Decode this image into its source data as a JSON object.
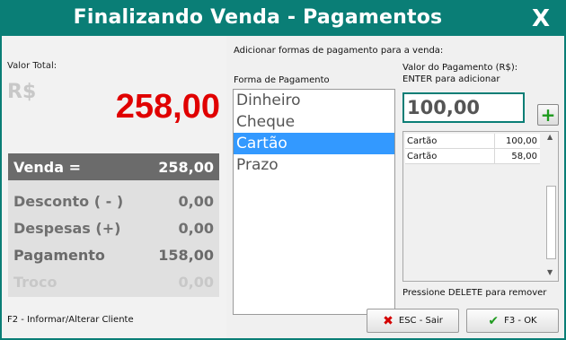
{
  "window": {
    "title": "Finalizando Venda - Pagamentos",
    "close_label": "X"
  },
  "left": {
    "total_label": "Valor Total:",
    "currency": "R$",
    "total_value": "258,00",
    "rows": [
      {
        "label": "Venda =",
        "value": "258,00"
      },
      {
        "label": "Desconto ( - )",
        "value": "0,00"
      },
      {
        "label": "Despesas (+)",
        "value": "0,00"
      },
      {
        "label": "Pagamento",
        "value": "158,00"
      },
      {
        "label": "Troco",
        "value": "0,00"
      }
    ],
    "hint": "F2 - Informar/Alterar Cliente"
  },
  "right": {
    "header": "Adicionar formas de pagamento para a venda:",
    "forma_label": "Forma de Pagamento",
    "valor_label_1": "Valor do Pagamento (R$):",
    "valor_label_2": "ENTER para adicionar",
    "forms": [
      "Dinheiro",
      "Cheque",
      "Cartão",
      "Prazo"
    ],
    "selected_index": 2,
    "amount_value": "100,00",
    "add_label": "+",
    "payments": [
      {
        "form": "Cartão",
        "value": "100,00"
      },
      {
        "form": "Cartão",
        "value": "58,00"
      }
    ],
    "delete_hint": "Pressione DELETE para remover",
    "esc_label": "ESC - Sair",
    "ok_label": "F3 - OK"
  },
  "colors": {
    "title_bar": "#0a7e76",
    "total": "#e00000",
    "selection": "#3399ff",
    "add_icon": "#1c9a1c"
  }
}
